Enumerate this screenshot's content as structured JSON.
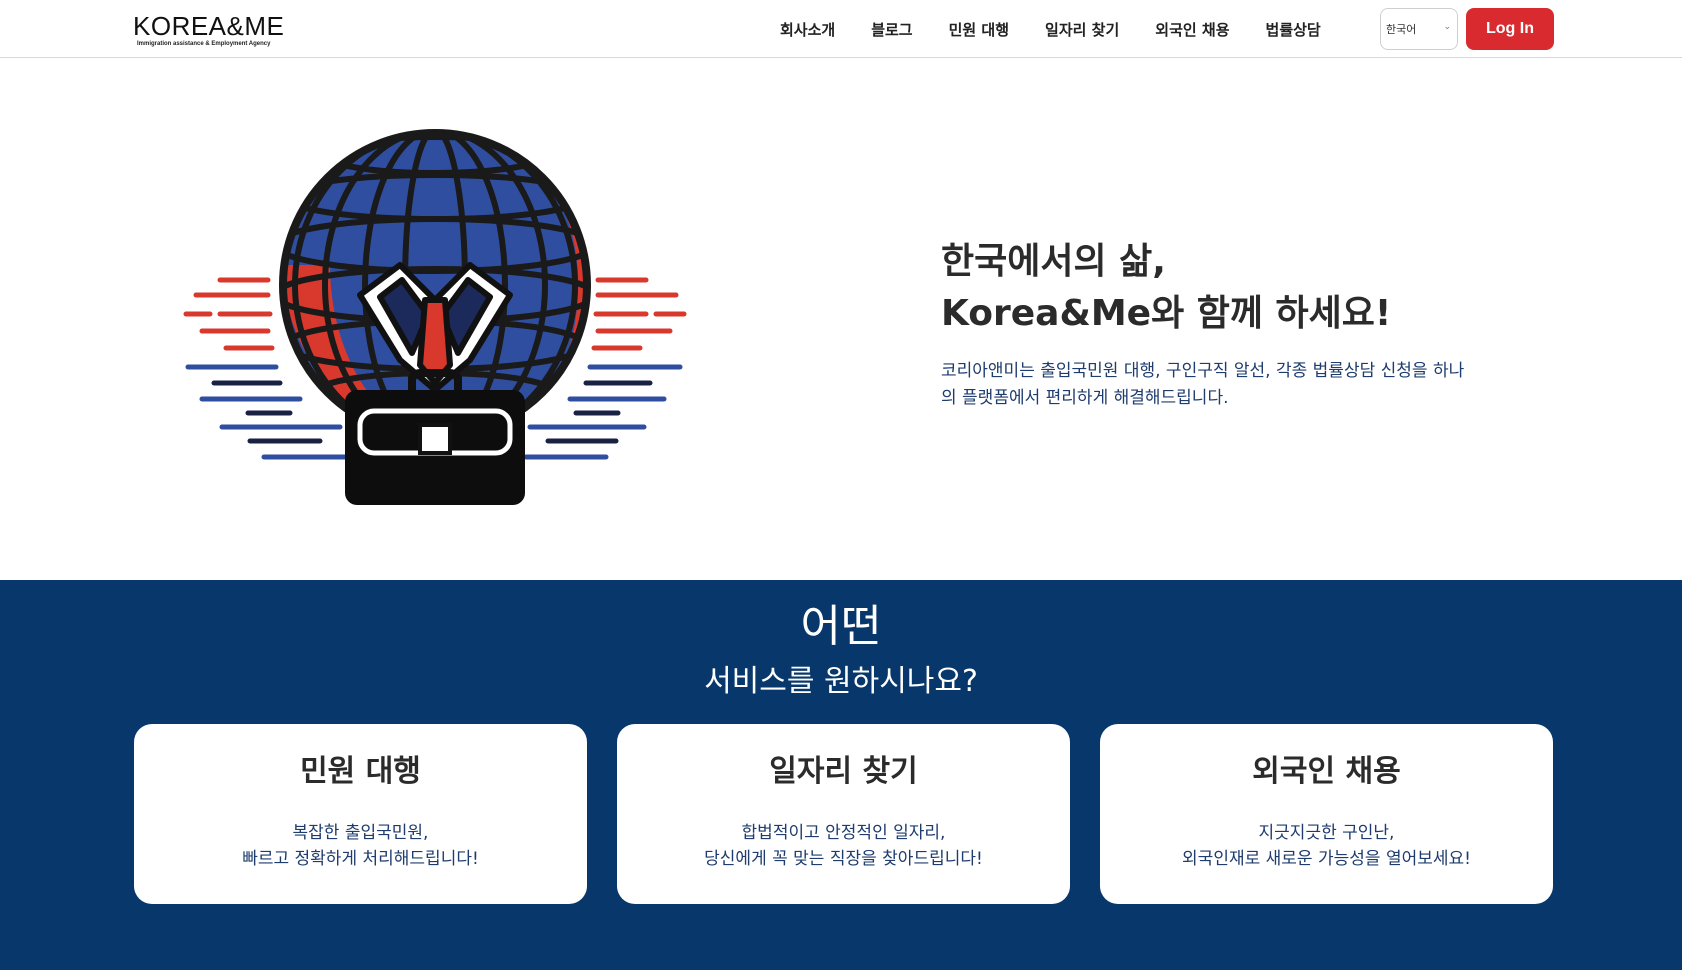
{
  "header": {
    "logo_main": "KOREA&ME",
    "logo_sub": "Immigration assistance & Employment Agency",
    "nav": [
      "회사소개",
      "블로그",
      "민원 대행",
      "일자리 찾기",
      "외국인 채용",
      "법률상담"
    ],
    "language_selected": "한국어",
    "login_label": "Log In"
  },
  "hero": {
    "title_line1": "한국에서의 삶,",
    "title_line2": "Korea&Me와 함께 하세요!",
    "desc_line1": "코리아앤미는 출입국민원 대행, 구인구직 알선, 각종 법률상담 신청을 하나",
    "desc_line2": "의 플랫폼에서 편리하게 해결해드립니다."
  },
  "services": {
    "title": "어떤",
    "subtitle": "서비스를 원하시나요?",
    "cards": [
      {
        "title": "민원 대행",
        "line1": "복잡한 출입국민원,",
        "line2": "빠르고 정확하게 처리해드립니다!"
      },
      {
        "title": "일자리 찾기",
        "line1": "합법적이고 안정적인 일자리,",
        "line2": "당신에게 꼭 맞는 직장을 찾아드립니다!"
      },
      {
        "title": "외국인 채용",
        "line1": "지긋지긋한 구인난,",
        "line2": "외국인재로 새로운 가능성을 열어보세요!"
      }
    ]
  },
  "colors": {
    "navy": "#07376b",
    "red": "#d92b2f",
    "globe_blue": "#2f4ea0",
    "globe_red": "#d9382c"
  },
  "icons": [
    "globe-briefcase-illustration",
    "chevron-down-icon"
  ]
}
